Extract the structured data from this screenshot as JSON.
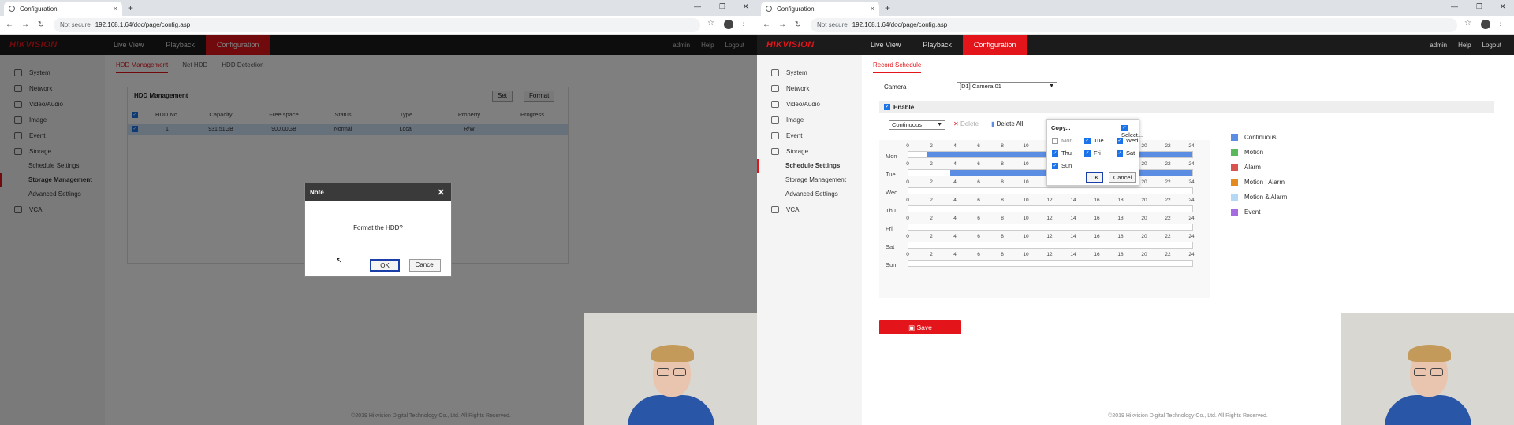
{
  "browser": {
    "tab_title": "Configuration",
    "security": "Not secure",
    "url": "192.168.1.64/doc/page/config.asp"
  },
  "nav": {
    "logo": "HIKVISION",
    "live_view": "Live View",
    "playback": "Playback",
    "configuration": "Configuration",
    "user": "admin",
    "help": "Help",
    "logout": "Logout"
  },
  "sidebar": {
    "items": [
      "System",
      "Network",
      "Video/Audio",
      "Image",
      "Event",
      "Storage"
    ],
    "sub": [
      "Schedule Settings",
      "Storage Management",
      "Advanced Settings"
    ],
    "vca": "VCA"
  },
  "left": {
    "tabs": [
      "HDD Management",
      "Net HDD",
      "HDD Detection"
    ],
    "box_title": "HDD Management",
    "set": "Set",
    "format": "Format",
    "headers": [
      "HDD No.",
      "Capacity",
      "Free space",
      "Status",
      "Type",
      "Property",
      "Progress"
    ],
    "row": [
      "1",
      "931.51GB",
      "900.00GB",
      "Normal",
      "Local",
      "R/W",
      ""
    ],
    "dialog": {
      "title": "Note",
      "message": "Format the HDD?",
      "ok": "OK",
      "cancel": "Cancel"
    },
    "footer": "©2019 Hikvision Digital Technology Co., Ltd. All Rights Reserved."
  },
  "right": {
    "tab": "Record Schedule",
    "camera_label": "Camera",
    "camera_value": "[D1] Camera 01",
    "enable": "Enable",
    "mode": "Continuous",
    "delete": "Delete",
    "delete_all": "Delete All",
    "hours": [
      "0",
      "2",
      "4",
      "6",
      "8",
      "10",
      "12",
      "14",
      "16",
      "18",
      "20",
      "22",
      "24"
    ],
    "days": [
      "Mon",
      "Tue",
      "Wed",
      "Thu",
      "Fri",
      "Sat",
      "Sun"
    ],
    "fills": [
      {
        "day": "Mon",
        "from": 1.5,
        "to": 24
      },
      {
        "day": "Tue",
        "from": 3.5,
        "to": 24
      }
    ],
    "copy": {
      "title": "Copy...",
      "select_all": "Select...",
      "days": [
        {
          "label": "Mon",
          "checked": false
        },
        {
          "label": "Tue",
          "checked": true
        },
        {
          "label": "Wed",
          "checked": true
        },
        {
          "label": "Thu",
          "checked": true
        },
        {
          "label": "Fri",
          "checked": true
        },
        {
          "label": "Sat",
          "checked": true
        },
        {
          "label": "Sun",
          "checked": true
        }
      ],
      "ok": "OK",
      "cancel": "Cancel"
    },
    "legend": [
      {
        "label": "Continuous",
        "color": "#5b8de3"
      },
      {
        "label": "Motion",
        "color": "#5cb85c"
      },
      {
        "label": "Alarm",
        "color": "#d9534f"
      },
      {
        "label": "Motion | Alarm",
        "color": "#e58a1f"
      },
      {
        "label": "Motion & Alarm",
        "color": "#b5d9f5"
      },
      {
        "label": "Event",
        "color": "#a56be0"
      }
    ],
    "save": "Save",
    "footer": "©2019 Hikvision Digital Technology Co., Ltd. All Rights Reserved."
  }
}
